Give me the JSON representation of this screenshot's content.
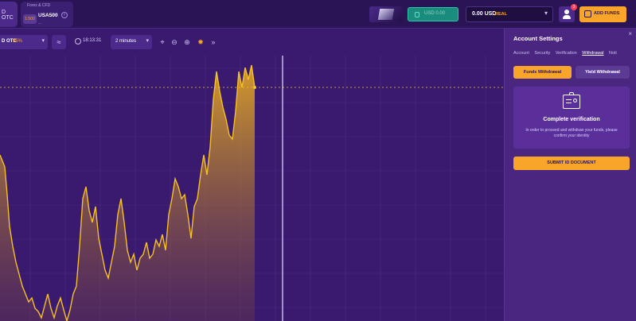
{
  "topbar": {
    "left_tab_label": "D OTC",
    "asset_tab": {
      "category": "Forex & CFD",
      "leverage": "1:500",
      "symbol": "USA500",
      "sub": "..."
    },
    "demo_label": "USD 0.00",
    "account": {
      "amount": "0.00 USD",
      "type": "REAL"
    },
    "notification_count": "3",
    "add_funds_label": "ADD FUNDS"
  },
  "toolbar": {
    "asset_name": "D OTC",
    "asset_payout": "95%",
    "time": "18:13:31",
    "timeframe": "2 minutes"
  },
  "panel": {
    "title": "Account Settings",
    "tabs": [
      "Account",
      "Security",
      "Verification",
      "Withdrawal",
      "Noti"
    ],
    "active_tab": "Withdrawal",
    "funds_withdrawal_label": "Funds Withdrawal",
    "yield_withdrawal_label": "Yield Withdrawal",
    "verify_title": "Complete verification",
    "verify_text": "In order to proceed and withdraw your funds, please confirm your identity",
    "submit_label": "SUBMIT ID DOCUMENT"
  },
  "colors": {
    "accent": "#f9a52a",
    "background": "#3a1a6e",
    "panel": "#4a2680"
  },
  "icons": [
    "chart-type-icon",
    "clock-icon",
    "drawing-tool-icon",
    "zoom-out-icon",
    "zoom-in-icon",
    "settings-icon",
    "double-chevron-icon",
    "user-icon",
    "wallet-icon",
    "id-card-icon"
  ]
}
